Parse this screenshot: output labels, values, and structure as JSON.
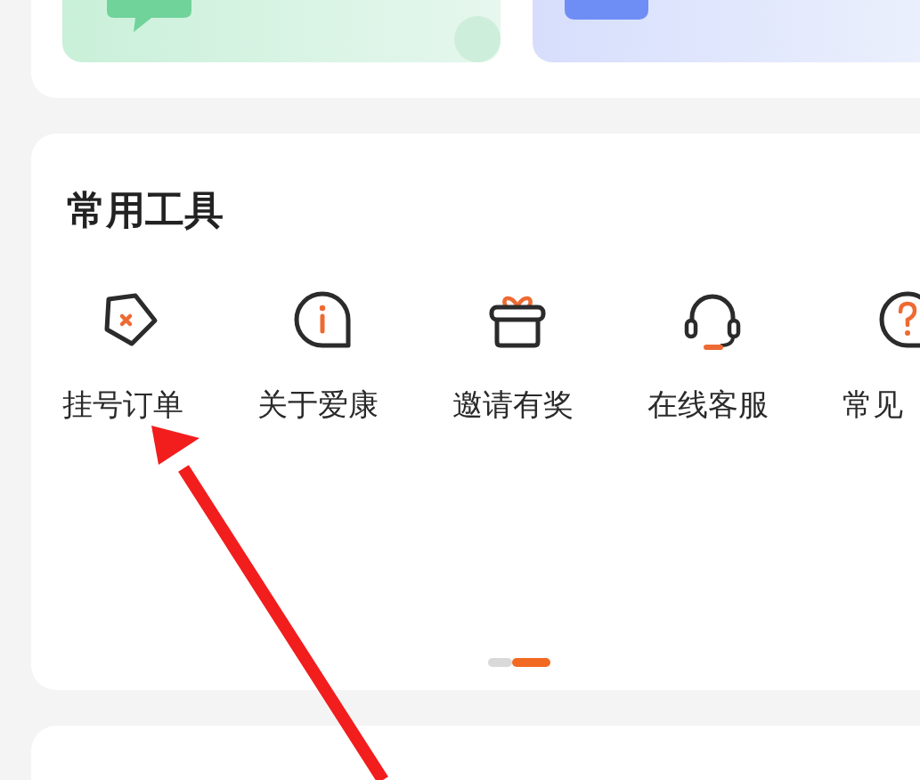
{
  "tools_section": {
    "title": "常用工具",
    "items": [
      {
        "label": "挂号订单"
      },
      {
        "label": "关于爱康"
      },
      {
        "label": "邀请有奖"
      },
      {
        "label": "在线客服"
      },
      {
        "label": "常见"
      }
    ],
    "pages": [
      {
        "selected": false
      },
      {
        "selected": true
      }
    ]
  }
}
